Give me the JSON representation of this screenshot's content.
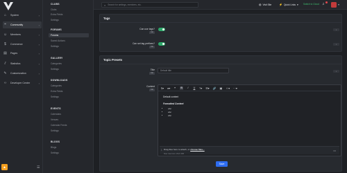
{
  "nav": {
    "items": [
      {
        "label": "System",
        "icon": "home-icon",
        "active": false
      },
      {
        "label": "Community",
        "icon": "chat-bubbles-icon",
        "active": true
      },
      {
        "label": "Members",
        "icon": "users-icon",
        "active": false
      },
      {
        "label": "Commerce",
        "icon": "dollar-icon",
        "active": false
      },
      {
        "label": "Pages",
        "icon": "pages-icon",
        "active": false
      },
      {
        "label": "Statistics",
        "icon": "chart-icon",
        "active": false
      },
      {
        "label": "Customization",
        "icon": "brush-icon",
        "active": false
      },
      {
        "label": "Developer Center",
        "icon": "code-icon",
        "active": false
      }
    ]
  },
  "subnav": {
    "clubs": {
      "title": "CLUBS",
      "links": [
        "Clubs",
        "Extra Fields",
        "Settings"
      ]
    },
    "forums": {
      "title": "FORUMS",
      "links": [
        "Forums",
        "Saved Actions",
        "Settings"
      ]
    },
    "gallery": {
      "title": "GALLERY",
      "links": [
        "Categories",
        "Settings"
      ]
    },
    "downloads": {
      "title": "DOWNLOADS",
      "links": [
        "Categories",
        "Extra Fields",
        "Settings"
      ]
    },
    "events": {
      "title": "EVENTS",
      "links": [
        "Calendars",
        "Venues",
        "Calendar Feeds",
        "Settings"
      ]
    },
    "blogs": {
      "title": "BLOGS",
      "links": [
        "Blogs",
        "Settings"
      ]
    }
  },
  "topbar": {
    "search_placeholder": "Search for settings, members, etc.",
    "visit_site": "Visit Site",
    "quick_links": "Quick Links",
    "switch_cloud": "Switch to Cloud"
  },
  "tags_panel": {
    "title": "Tags",
    "fields": [
      {
        "label": "Can use tags?",
        "scope": "Clo",
        "enabled": true
      },
      {
        "label": "Can set tag prefixes?",
        "scope": "Clo",
        "enabled": true
      }
    ]
  },
  "topic_presets": {
    "title": "Topic Presets",
    "title_field": {
      "label": "Title",
      "scope": "Clo",
      "placeholder": "Default title"
    },
    "content_field": {
      "label": "Content",
      "scope": "Clo"
    },
    "editor": {
      "line1": "Default content",
      "line2": "Formatted Content",
      "bullets": [
        "abc",
        "abc",
        "abc"
      ],
      "attach_text": "Drag files here to attach, or ",
      "attach_link": "choose files...",
      "attach_hint": "Max total size 2021 MB"
    }
  },
  "save_label": "Save"
}
